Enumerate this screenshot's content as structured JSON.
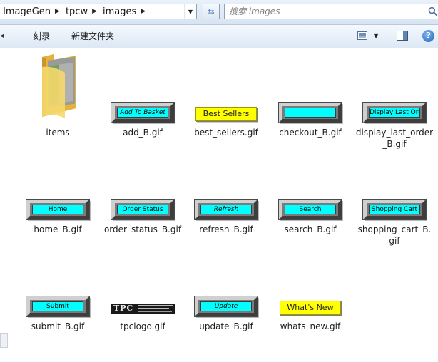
{
  "address": {
    "crumbs": [
      "ImageGen",
      "tpcw",
      "images"
    ],
    "search_placeholder": "搜索 images"
  },
  "toolbar": {
    "burn_label": "刻录",
    "new_folder_label": "新建文件夹"
  },
  "icons": {
    "refresh": "refresh-icon",
    "search": "search-icon",
    "view": "change-view-icon",
    "preview": "preview-pane-icon",
    "help": "help-icon"
  },
  "items": [
    {
      "name": "items",
      "kind": "folder"
    },
    {
      "name": "add_B.gif",
      "kind": "bevel",
      "caption": "Add To Basket",
      "italic": true
    },
    {
      "name": "best_sellers.gif",
      "kind": "yellow",
      "caption": "Best Sellers"
    },
    {
      "name": "checkout_B.gif",
      "kind": "bevel",
      "caption": ""
    },
    {
      "name": "display_last_order_B.gif",
      "kind": "bevel",
      "caption": "Display Last Order"
    },
    {
      "name": "home_B.gif",
      "kind": "bevel",
      "caption": "Home"
    },
    {
      "name": "order_status_B.gif",
      "kind": "bevel",
      "caption": "Order Status"
    },
    {
      "name": "refresh_B.gif",
      "kind": "bevel",
      "caption": "Refresh",
      "italic": true
    },
    {
      "name": "search_B.gif",
      "kind": "bevel",
      "caption": "Search"
    },
    {
      "name": "shopping_cart_B.gif",
      "kind": "bevel",
      "caption": "Shopping Cart"
    },
    {
      "name": "submit_B.gif",
      "kind": "bevel",
      "caption": "Submit"
    },
    {
      "name": "tpclogo.gif",
      "kind": "logo",
      "caption": "TPC"
    },
    {
      "name": "update_B.gif",
      "kind": "bevel",
      "caption": "Update",
      "italic": true
    },
    {
      "name": "whats_new.gif",
      "kind": "yellow",
      "caption": "What's New"
    }
  ],
  "colors": {
    "button_face": "#00ffff",
    "yellow_button": "#ffff00",
    "folder": "#f2c94c"
  }
}
